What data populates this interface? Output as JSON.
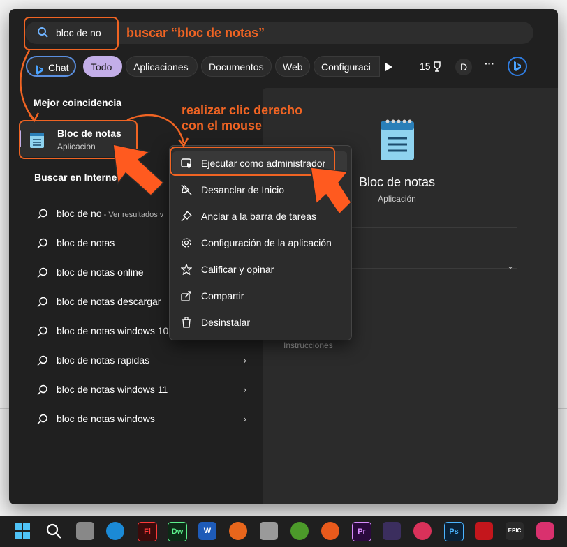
{
  "search": {
    "value": "bloc de no"
  },
  "filters": {
    "chat": "Chat",
    "todo": "Todo",
    "aplicaciones": "Aplicaciones",
    "documentos": "Documentos",
    "web": "Web",
    "configuracion": "Configuraci"
  },
  "toolbar": {
    "count": "15",
    "account_initial": "D",
    "more": "···"
  },
  "best_match": {
    "section_title": "Mejor coincidencia",
    "name": "Bloc de notas",
    "type": "Aplicación"
  },
  "web_search": {
    "section_title": "Buscar en Interne",
    "items": [
      {
        "text": "bloc de no",
        "suffix": " - Ver resultados v"
      },
      {
        "text": "bloc de notas",
        "suffix": ""
      },
      {
        "text": "bloc de notas online",
        "suffix": ""
      },
      {
        "text": "bloc de notas descargar",
        "suffix": ""
      },
      {
        "text": "bloc de notas windows 10",
        "suffix": ""
      },
      {
        "text": "bloc de notas rapidas",
        "suffix": ""
      },
      {
        "text": "bloc de notas windows 11",
        "suffix": ""
      },
      {
        "text": "bloc de notas windows",
        "suffix": ""
      }
    ]
  },
  "preview": {
    "title": "Bloc de notas",
    "subtitle": "Aplicación",
    "partial_item": "Instrucciones"
  },
  "context_menu": {
    "items": [
      {
        "label": "Ejecutar como administrador",
        "icon": "admin-shield-icon"
      },
      {
        "label": "Desanclar de Inicio",
        "icon": "unpin-icon"
      },
      {
        "label": "Anclar a la barra de tareas",
        "icon": "pin-icon"
      },
      {
        "label": "Configuración de la aplicación",
        "icon": "gear-icon"
      },
      {
        "label": "Calificar y opinar",
        "icon": "star-icon"
      },
      {
        "label": "Compartir",
        "icon": "share-icon"
      },
      {
        "label": "Desinstalar",
        "icon": "trash-icon"
      }
    ]
  },
  "annotations": {
    "search_label": "buscar “bloc de notas”",
    "right_click_line1": "realizar clic derecho",
    "right_click_line2": "con el mouse"
  },
  "taskbar": {
    "icons": [
      "Fl",
      "Dw",
      "W",
      "Pr",
      "Ps",
      "EPIC"
    ]
  },
  "colors": {
    "accent": "#c3aee8",
    "annotation": "#f06423",
    "panel": "#202020"
  }
}
